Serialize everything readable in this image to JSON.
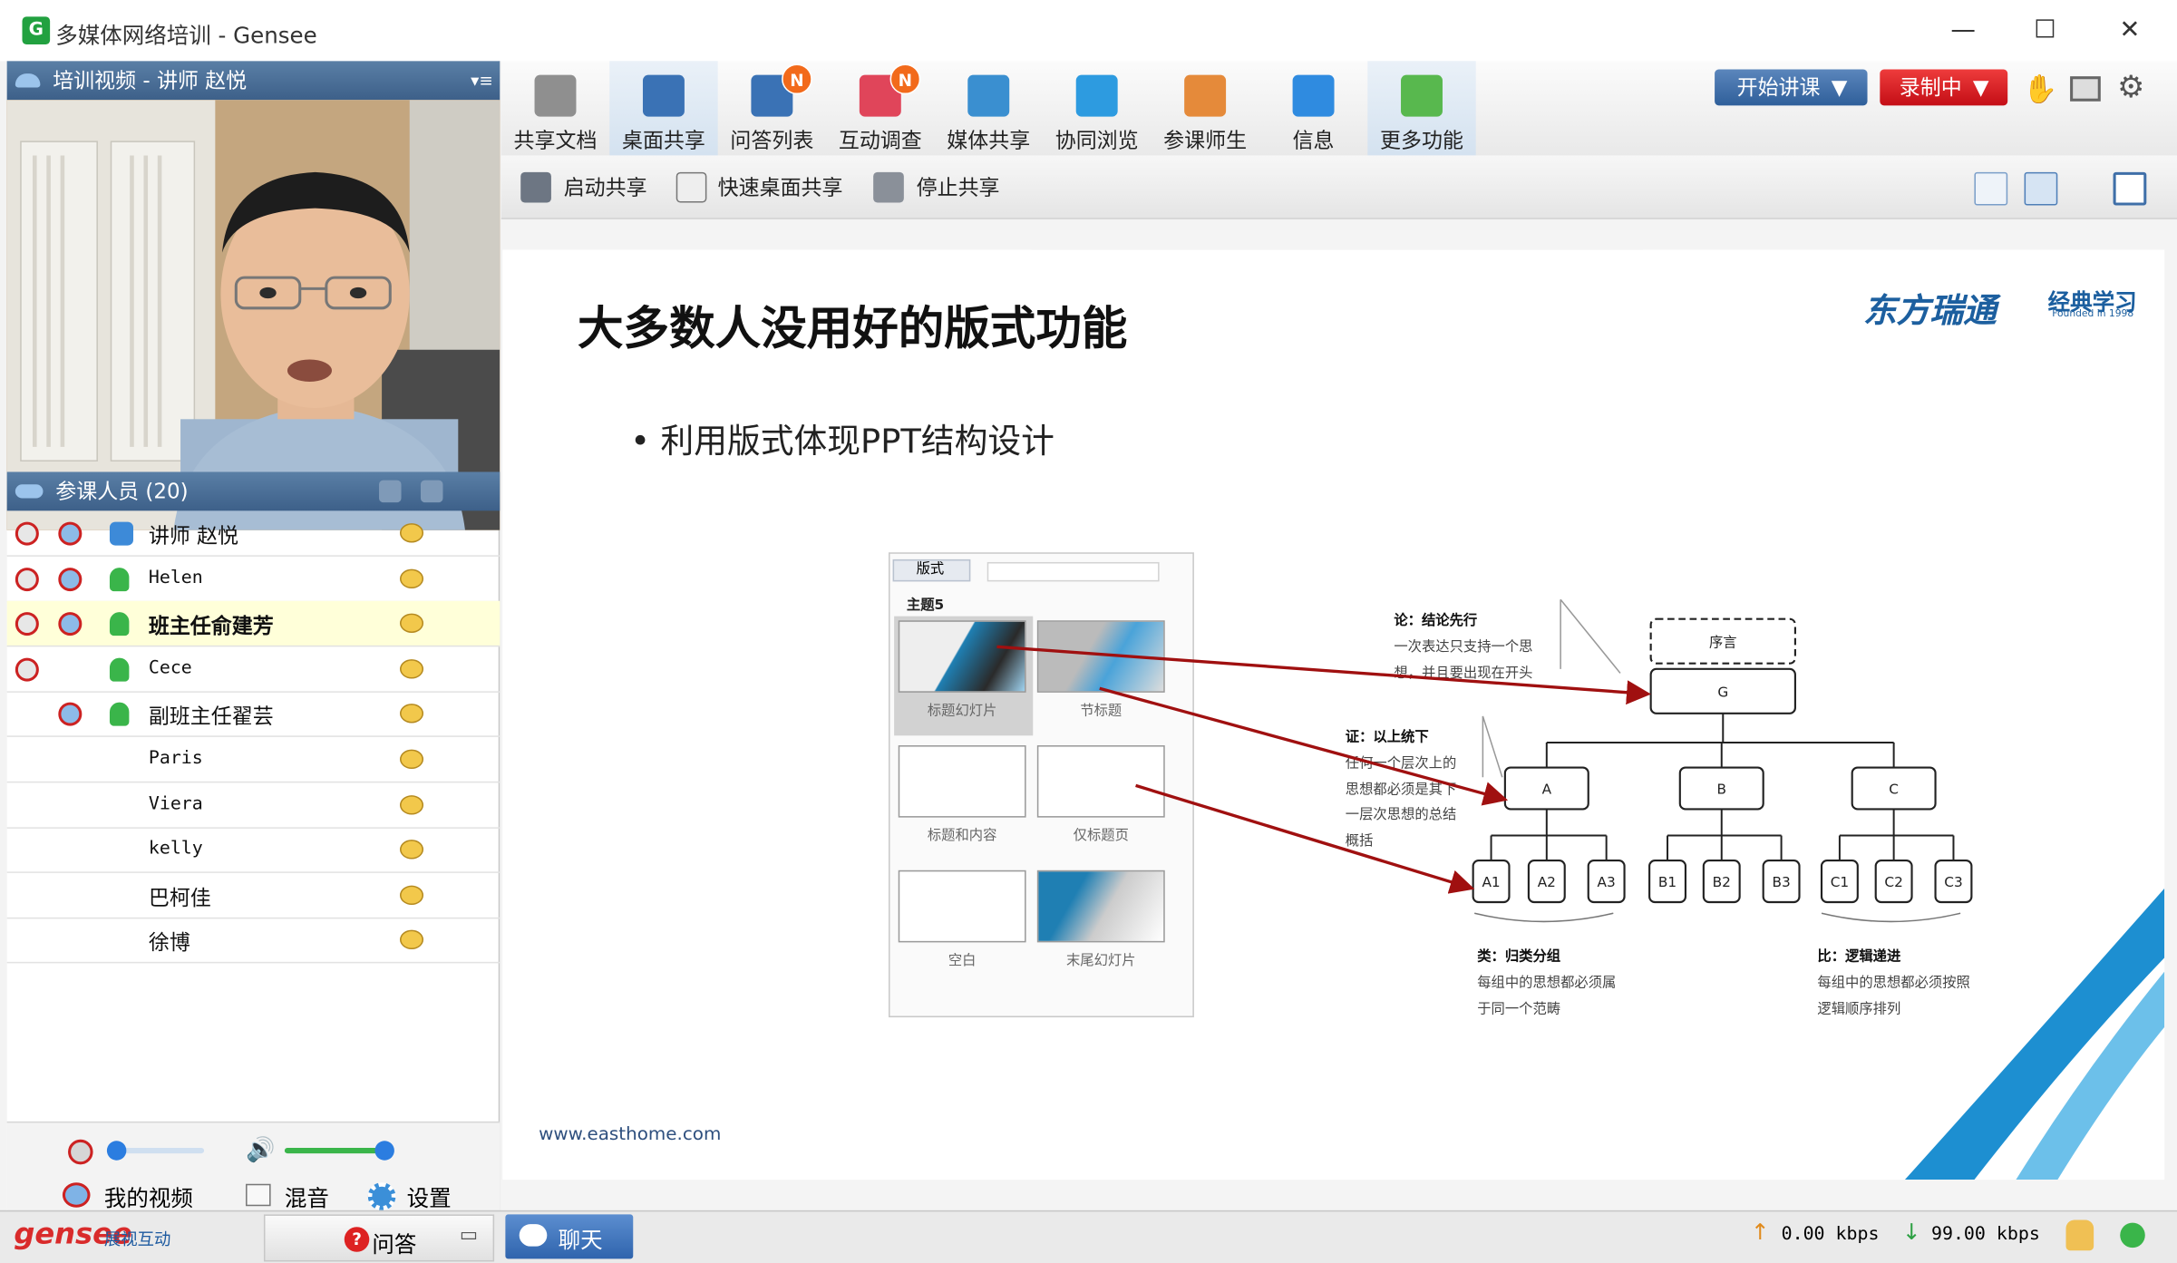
{
  "window": {
    "title": "多媒体网络培训 - Gensee",
    "app_icon": "gensee-app-icon",
    "minimize": "—",
    "maximize": "☐",
    "close": "✕"
  },
  "video_panel": {
    "title": "培训视频 - 讲师 赵悦"
  },
  "participants": {
    "title": "参课人员 (20)",
    "list": [
      {
        "name": "讲师 赵悦",
        "mono": false,
        "bold": false,
        "selected": false
      },
      {
        "name": "Helen",
        "mono": true,
        "bold": false,
        "selected": false
      },
      {
        "name": "班主任俞建芳",
        "mono": false,
        "bold": true,
        "selected": true
      },
      {
        "name": "Cece",
        "mono": true,
        "bold": false,
        "selected": false
      },
      {
        "name": "副班主任翟芸",
        "mono": false,
        "bold": false,
        "selected": false
      },
      {
        "name": "Paris",
        "mono": true,
        "bold": false,
        "selected": false
      },
      {
        "name": "Viera",
        "mono": true,
        "bold": false,
        "selected": false
      },
      {
        "name": "kelly",
        "mono": true,
        "bold": false,
        "selected": false
      },
      {
        "name": "巴柯佳",
        "mono": false,
        "bold": false,
        "selected": false
      },
      {
        "name": "徐博",
        "mono": false,
        "bold": false,
        "selected": false
      }
    ]
  },
  "controls": {
    "mic_level": 0.0,
    "speaker_level": 1.0,
    "my_video": "我的视频",
    "mix": "混音",
    "settings": "设置"
  },
  "toolbar": {
    "items": [
      {
        "label": "共享文档",
        "icon": "document-icon",
        "color": "#8f8f8f",
        "active": false,
        "badge": ""
      },
      {
        "label": "桌面共享",
        "icon": "desktop-share-icon",
        "color": "#3a72b5",
        "active": true,
        "badge": ""
      },
      {
        "label": "问答列表",
        "icon": "qa-list-icon",
        "color": "#3a72b5",
        "active": false,
        "badge": "N"
      },
      {
        "label": "互动调查",
        "icon": "survey-chart-icon",
        "color": "#e0455a",
        "active": false,
        "badge": "N"
      },
      {
        "label": "媒体共享",
        "icon": "media-share-icon",
        "color": "#3a8fd0",
        "active": false,
        "badge": ""
      },
      {
        "label": "协同浏览",
        "icon": "ie-browser-icon",
        "color": "#2d9be0",
        "active": false,
        "badge": ""
      },
      {
        "label": "参课师生",
        "icon": "users-icon",
        "color": "#e58a3a",
        "active": false,
        "badge": ""
      },
      {
        "label": "信息",
        "icon": "info-icon",
        "color": "#2f8be0",
        "active": false,
        "badge": ""
      },
      {
        "label": "更多功能",
        "icon": "more-apps-icon",
        "color": "#58b84e",
        "active": true,
        "badge": ""
      }
    ],
    "start_lecture": "开始讲课",
    "recording": "录制中"
  },
  "subtoolbar": {
    "start_share": "启动共享",
    "quick_share": "快速桌面共享",
    "stop_share": "停止共享"
  },
  "slide": {
    "title": "大多数人没用好的版式功能",
    "bullet": "• 利用版式体现PPT结构设计",
    "logo_main": "东方瑞通",
    "logo_sub": "经典学习",
    "logo_founded": "Founded in 1998",
    "footer": "www.easthome.com",
    "layout_panel": {
      "button": "版式",
      "group": "主题5",
      "items": [
        "标题幻灯片",
        "节标题",
        "标题和内容",
        "仅标题页",
        "空白",
        "末尾幻灯片"
      ]
    },
    "diagram": {
      "preface": "序言",
      "root": "G",
      "mid": [
        "A",
        "B",
        "C"
      ],
      "leaves": [
        "A1",
        "A2",
        "A3",
        "B1",
        "B2",
        "B3",
        "C1",
        "C2",
        "C3"
      ],
      "note_lun_title": "论：结论先行",
      "note_lun_lines": [
        "一次表达只支持一个思",
        "想，并且要出现在开头"
      ],
      "note_zheng_title": "证：以上统下",
      "note_zheng_lines": [
        "任何一个层次上的",
        "思想都必须是其下",
        "一层次思想的总结",
        "概括"
      ],
      "note_lei_title": "类：归类分组",
      "note_lei_lines": [
        "每组中的思想都必须属",
        "于同一个范畴"
      ],
      "note_bi_title": "比：逻辑递进",
      "note_bi_lines": [
        "每组中的思想都必须按照",
        "逻辑顺序排列"
      ]
    }
  },
  "status": {
    "brand": "gensee",
    "brand_sub": "展视互动",
    "qa_tab": "问答",
    "chat_tab": "聊天",
    "upload": "0.00 kbps",
    "download": "99.00 kbps"
  },
  "colors": {
    "accent_blue": "#3d6089",
    "record_red": "#d0111c",
    "arrow_red": "#a01010",
    "panel_blue": "#4b79b1"
  }
}
